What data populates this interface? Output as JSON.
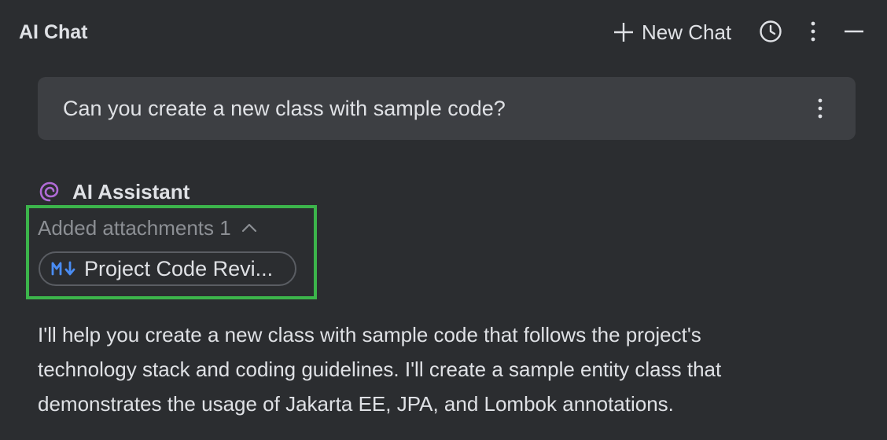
{
  "header": {
    "title": "AI Chat",
    "new_chat_label": "New Chat",
    "icons": [
      "plus-icon",
      "history-icon",
      "more-vertical-icon",
      "minimize-icon"
    ]
  },
  "user_message": {
    "text": "Can you create a new class with sample code?"
  },
  "assistant": {
    "name": "AI Assistant",
    "attachments_label": "Added attachments 1",
    "attachment_chip_label": "Project Code Revi...",
    "response_lines": [
      "I'll help you create a new class with sample code that follows the project's",
      "technology stack and coding guidelines. I'll create a sample entity class that",
      "demonstrates the usage of Jakarta EE, JPA, and Lombok annotations."
    ]
  },
  "colors": {
    "background": "#2b2d30",
    "bubble": "#3d3f43",
    "text": "#dfe1e5",
    "muted": "#8c8f94",
    "highlight": "#3cb44b",
    "assistant_logo": "#b06bd6",
    "markdown_icon": "#4a8cf2"
  }
}
